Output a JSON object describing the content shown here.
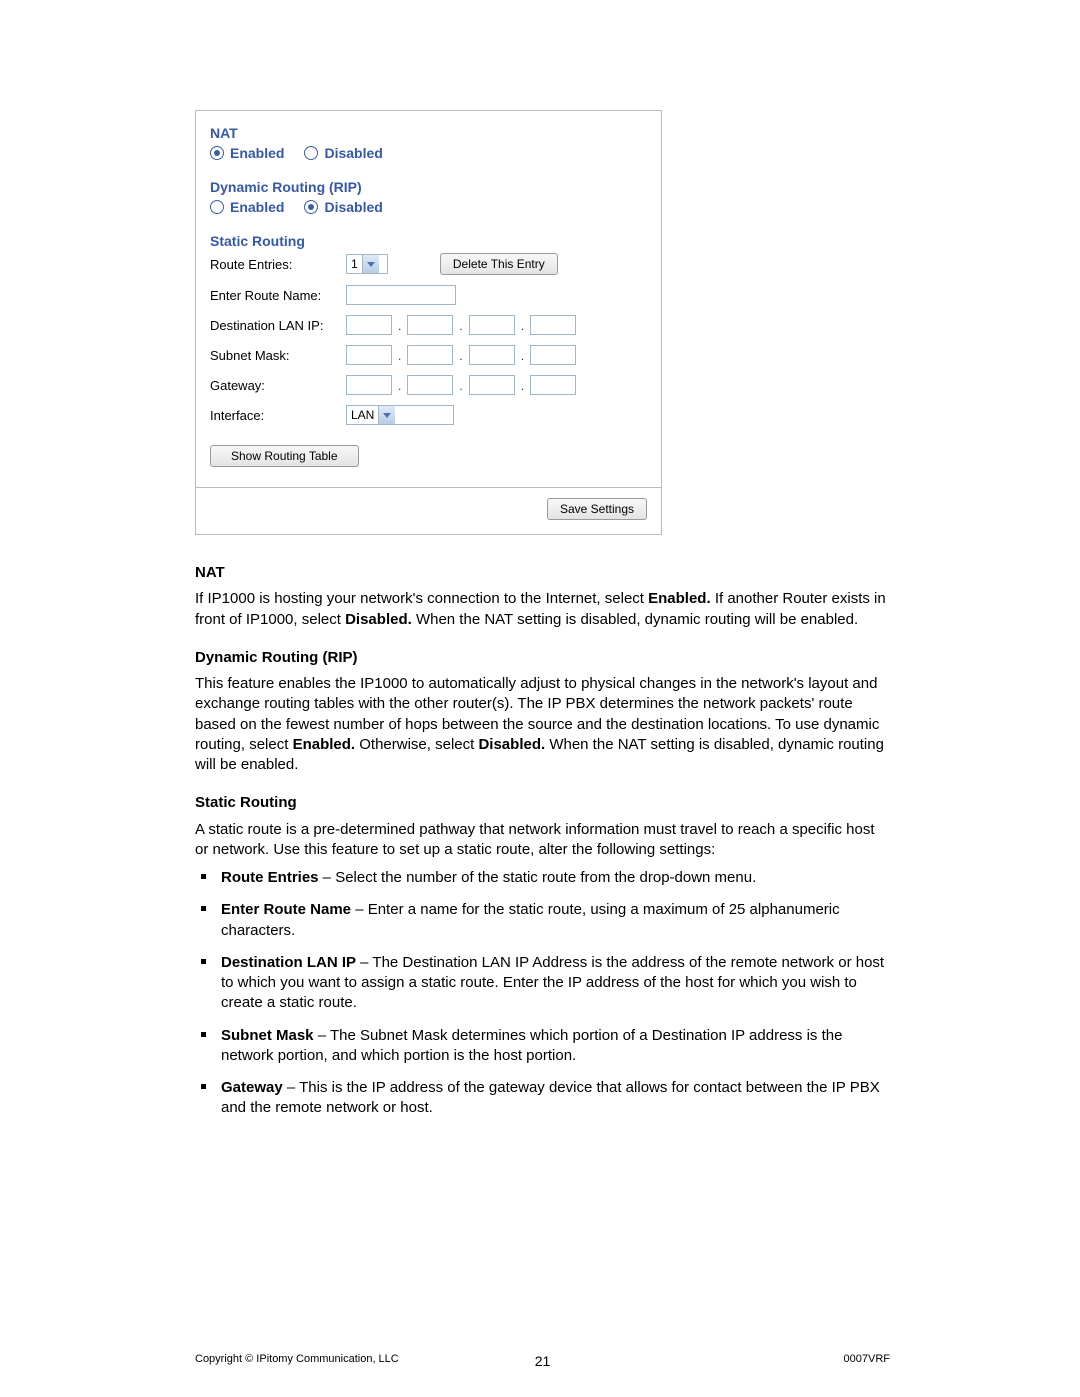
{
  "config": {
    "nat": {
      "title": "NAT",
      "enabled_label": "Enabled",
      "disabled_label": "Disabled",
      "selected": "enabled"
    },
    "rip": {
      "title": "Dynamic Routing (RIP)",
      "enabled_label": "Enabled",
      "disabled_label": "Disabled",
      "selected": "disabled"
    },
    "static_routing": {
      "title": "Static Routing",
      "route_entries_label": "Route Entries:",
      "route_entries_value": "1",
      "delete_button": "Delete This Entry",
      "route_name_label": "Enter Route Name:",
      "route_name_value": "",
      "dest_lan_ip_label": "Destination LAN IP:",
      "subnet_mask_label": "Subnet Mask:",
      "gateway_label": "Gateway:",
      "interface_label": "Interface:",
      "interface_value": "LAN",
      "show_table_button": "Show Routing Table"
    },
    "save_button": "Save Settings"
  },
  "doc": {
    "nat_heading": "NAT",
    "nat_p_a": "If IP1000 is hosting your network's connection to the Internet, select ",
    "nat_enabled": "Enabled.",
    "nat_p_b": " If another Router exists in front of IP1000, select ",
    "nat_disabled": "Disabled.",
    "nat_p_c": " When the NAT setting is disabled, dynamic routing will be enabled.",
    "rip_heading": "Dynamic Routing (RIP)",
    "rip_p_a": "This feature enables the IP1000 to automatically adjust to physical changes in the network's layout and exchange routing tables with the other router(s). The IP PBX determines the network packets' route based on the fewest number of hops between the source and the destination locations. To use dynamic routing, select ",
    "rip_enabled": "Enabled.",
    "rip_p_b": " Otherwise, select ",
    "rip_disabled": "Disabled.",
    "rip_p_c": " When the NAT setting is disabled, dynamic routing will be enabled.",
    "static_heading": "Static Routing",
    "static_p": "A static route is a pre-determined pathway that network information must travel to reach a specific host or network. Use this feature to set up a static route, alter the following settings:",
    "items": {
      "route_entries_b": "Route Entries",
      "route_entries_t": " – Select the number of the static route from the drop-down menu.",
      "route_name_b": "Enter Route Name",
      "route_name_t": " – Enter a name for the static route, using a maximum of 25 alphanumeric characters.",
      "dest_ip_b": "Destination LAN IP",
      "dest_ip_t": " – The Destination LAN IP Address is the address of the remote network or host to which you want to assign a static route. Enter the IP address of the host for which you wish to create a static route.",
      "subnet_b": "Subnet Mask",
      "subnet_t": " – The Subnet Mask determines which portion of a Destination IP address is the network portion, and which portion is the host portion.",
      "gateway_b": "Gateway",
      "gateway_t": " – This is the IP address of the gateway device that allows for contact between the IP PBX and the remote network or host."
    }
  },
  "footer": {
    "left": "Copyright © IPitomy Communication, LLC",
    "page": "21",
    "right": "0007VRF"
  }
}
